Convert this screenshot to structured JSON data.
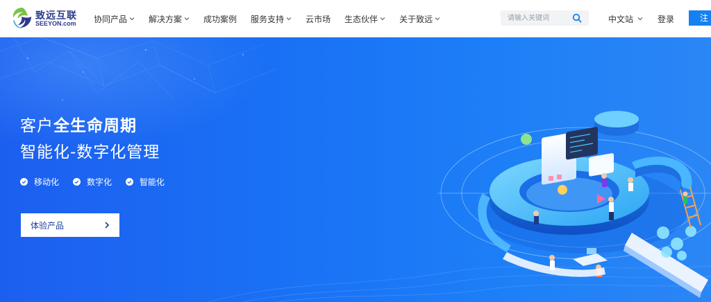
{
  "brand": {
    "name_cn": "致远互联",
    "name_en": "SEEYON.com",
    "colors": {
      "primary": "#1580f3",
      "brand_text": "#2d3a8c",
      "hero_bg": "#1a73f5"
    }
  },
  "nav": {
    "items": [
      {
        "label": "协同产品",
        "has_dropdown": true
      },
      {
        "label": "解决方案",
        "has_dropdown": true
      },
      {
        "label": "成功案例",
        "has_dropdown": false
      },
      {
        "label": "服务支持",
        "has_dropdown": true
      },
      {
        "label": "云市场",
        "has_dropdown": false
      },
      {
        "label": "生态伙伴",
        "has_dropdown": true
      },
      {
        "label": "关于致远",
        "has_dropdown": true
      }
    ]
  },
  "search": {
    "placeholder": "请输入关键词",
    "icon": "search-icon"
  },
  "header_right": {
    "language": "中文站",
    "login": "登录",
    "register": "注"
  },
  "hero": {
    "headline_line1_plain": "客户",
    "headline_line1_bold": "全生命周期",
    "headline_line2": "智能化-数字化管理",
    "features": [
      "移动化",
      "数字化",
      "智能化"
    ],
    "cta_label": "体验产品",
    "icons": {
      "feature": "check-circle-icon",
      "cta": "chevron-right-icon"
    }
  }
}
